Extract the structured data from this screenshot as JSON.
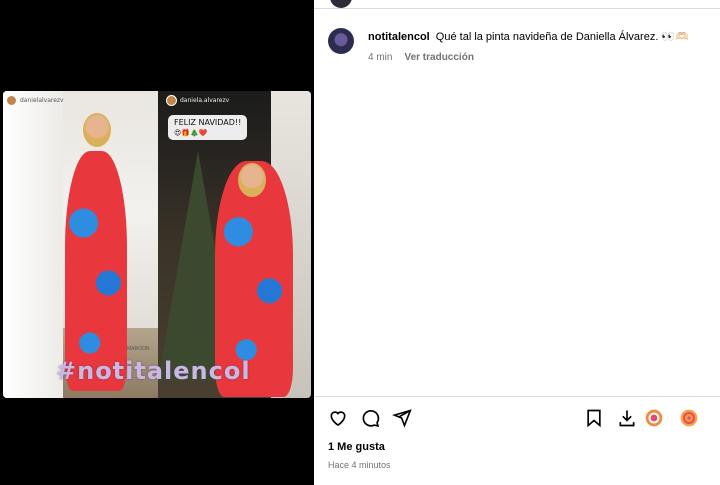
{
  "post": {
    "story_left_user": "danielalvarezv",
    "story_right_user": "daniela.alvarezv",
    "sticker_text": "FELIZ NAVIDAD!!",
    "sticker_emojis": "😍🎁🎄❤️",
    "watermark": "#notitalencol",
    "side_text": "MAROON"
  },
  "comment": {
    "username": "notitalencol",
    "caption": "Qué tal la pinta navideña de Daniella Álvarez. 👀🫶🏻",
    "time": "4 min",
    "translate": "Ver traducción"
  },
  "actions": {
    "like_icon": "heart-icon",
    "comment_icon": "comment-icon",
    "share_icon": "share-icon",
    "save_icon": "bookmark-icon",
    "download_icon": "download-icon"
  },
  "likes": "1 Me gusta",
  "timestamp": "Hace 4 minutos",
  "colors": {
    "accent_pink": "#e6476e",
    "accent_orange": "#f9a23a"
  }
}
